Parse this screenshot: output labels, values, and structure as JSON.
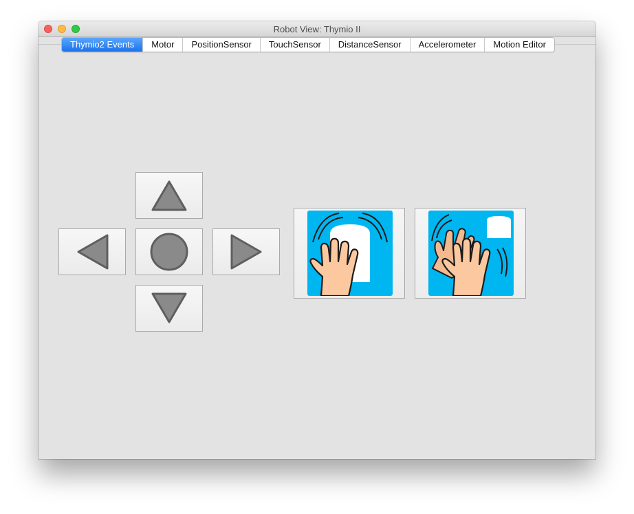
{
  "window": {
    "title": "Robot View: Thymio II",
    "controls": [
      "close",
      "minimize",
      "zoom"
    ]
  },
  "tabs": [
    {
      "label": "Thymio2 Events",
      "active": true
    },
    {
      "label": "Motor",
      "active": false
    },
    {
      "label": "PositionSensor",
      "active": false
    },
    {
      "label": "TouchSensor",
      "active": false
    },
    {
      "label": "DistanceSensor",
      "active": false
    },
    {
      "label": "Accelerometer",
      "active": false
    },
    {
      "label": "Motion Editor",
      "active": false
    }
  ],
  "dpad": {
    "up_icon": "triangle-up-icon",
    "left_icon": "triangle-left-icon",
    "center_icon": "circle-icon",
    "right_icon": "triangle-right-icon",
    "down_icon": "triangle-down-icon",
    "icon_fill": "#8a8a8a",
    "icon_stroke": "#5f5f5f"
  },
  "events": [
    {
      "icon": "tap-hand-icon"
    },
    {
      "icon": "shake-hands-icon"
    }
  ],
  "colors": {
    "accent": "#1a73ec",
    "event_tile": "#00b6f0",
    "window_bg": "#e3e3e3"
  }
}
